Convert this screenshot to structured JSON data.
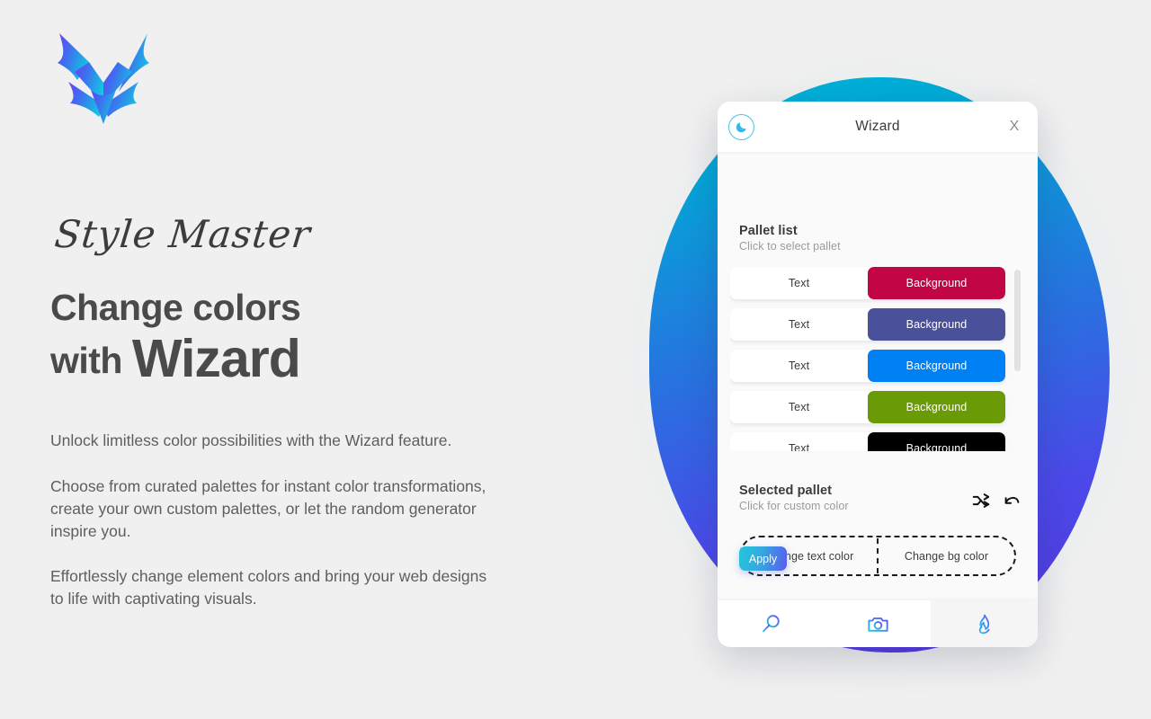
{
  "brand": {
    "logo_icon": "chevron-arrow-logo",
    "logo_gradient_from": "#5b4ef5",
    "logo_gradient_to": "#18c8e0"
  },
  "hero": {
    "script_title": "Style Master",
    "headline_line1": "Change colors",
    "headline_with": "with ",
    "headline_emphasis": "Wizard",
    "paragraphs": [
      "Unlock limitless color possibilities with the Wizard feature.",
      "Choose from curated palettes for instant color transformations, create your own custom palettes, or let the random generator inspire you.",
      "Effortlessly change element colors and bring your web designs to life with captivating visuals."
    ]
  },
  "backdrop": {
    "blob_gradient_from": "#00b4d8",
    "blob_gradient_to": "#5536dd",
    "page_background": "#f0f0f0"
  },
  "panel": {
    "header": {
      "theme_toggle_icon": "moon-icon",
      "title": "Wizard",
      "close_label": "X"
    },
    "pallet_section": {
      "title": "Pallet list",
      "subtitle": "Click to select pallet",
      "text_label": "Text",
      "background_label": "Background",
      "rows": [
        {
          "text_bg": "#ffffff",
          "text_color": "#3a3a3a",
          "bg_color": "#c10545",
          "bg_text_color": "#ffffff"
        },
        {
          "text_bg": "#ffffff",
          "text_color": "#3a3a3a",
          "bg_color": "#4b509b",
          "bg_text_color": "#ffffff"
        },
        {
          "text_bg": "#ffffff",
          "text_color": "#3a3a3a",
          "bg_color": "#0080f5",
          "bg_text_color": "#ffffff"
        },
        {
          "text_bg": "#ffffff",
          "text_color": "#3a3a3a",
          "bg_color": "#6a9a06",
          "bg_text_color": "#ffffff"
        },
        {
          "text_bg": "#ffffff",
          "text_color": "#3a3a3a",
          "bg_color": "#000000",
          "bg_text_color": "#ffffff"
        }
      ]
    },
    "selected_section": {
      "title": "Selected pallet",
      "subtitle": "Click for custom color",
      "shuffle_icon": "shuffle-icon",
      "undo_icon": "undo-icon",
      "change_text_label": "Change text color",
      "change_bg_label": "Change bg color",
      "apply_label": "Apply",
      "apply_gradient_from": "#24c6dc",
      "apply_gradient_to": "#5b5bf0"
    },
    "tabs": [
      {
        "icon": "search-icon",
        "active": false
      },
      {
        "icon": "camera-icon",
        "active": false
      },
      {
        "icon": "flame-icon",
        "active": true
      }
    ]
  }
}
